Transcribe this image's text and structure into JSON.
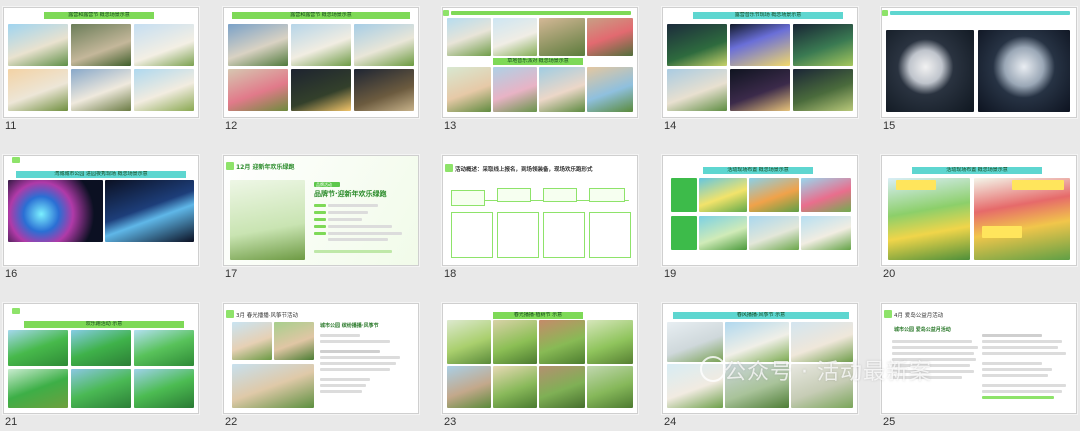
{
  "slides": [
    {
      "num": "11",
      "title": "露营和露营节 概念场景示意"
    },
    {
      "num": "12",
      "title": "露营和露营节 概念场景示意"
    },
    {
      "num": "13",
      "title": "",
      "subtitle": "草地音乐派对 概念场景示意"
    },
    {
      "num": "14",
      "title": "露营音乐节现场 概念场景示意"
    },
    {
      "num": "15",
      "title": "",
      "subtitle": ""
    },
    {
      "num": "16",
      "title": "湾城城市公园 进园夜秀现场 概念场景示意"
    },
    {
      "num": "17",
      "title": "12月 迎新年欢乐绿跑",
      "subtitle": "品牌节·迎新年欢乐绿跑",
      "badge": "品牌活动"
    },
    {
      "num": "18",
      "title": "活动概述：采取线上报名，到场领装备，现场欢乐跑形式"
    },
    {
      "num": "19",
      "title": "活动现场布置 概念场景示意"
    },
    {
      "num": "20",
      "title": "活动现场布置 概念场景示意"
    },
    {
      "num": "21",
      "title": "欢乐跑活动 示意"
    },
    {
      "num": "22",
      "title": "3月 春光播播·风筝节活动",
      "subtitle": "城市公园 缤纷播播·风筝节"
    },
    {
      "num": "23",
      "title": "春光播播·植树节 示意"
    },
    {
      "num": "24",
      "title": "春风播播·风筝节 示意"
    },
    {
      "num": "25",
      "title": "4月 爱岛公益月活动",
      "subtitle": "城市公园 爱岛公益月活动"
    }
  ],
  "watermark": "公众号 · 活动最新案"
}
